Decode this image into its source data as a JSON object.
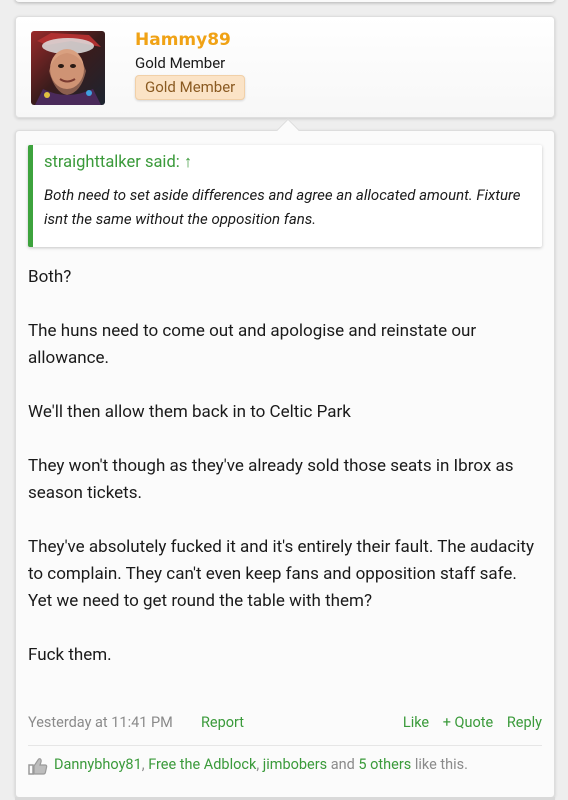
{
  "user": {
    "name": "Hammy89",
    "title": "Gold Member",
    "badge": "Gold Member"
  },
  "quote": {
    "author": "straighttalker said: ↑",
    "text": "Both need to set aside differences and agree an allocated amount. Fixture isnt the same without the opposition fans."
  },
  "post": {
    "paragraphs": [
      "Both?",
      "The huns need to come out and apologise and reinstate our allowance.",
      "We'll then allow them back in to Celtic Park",
      "They won't though as they've already sold those seats in Ibrox as season tickets.",
      "They've absolutely fucked it and it's entirely their fault. The audacity to complain. They can't even keep fans and opposition staff safe. Yet we need to get round the table with them?",
      "Fuck them."
    ],
    "timestamp": "Yesterday at 11:41 PM",
    "report": "Report",
    "like": "Like",
    "quote_action": "+ Quote",
    "reply": "Reply"
  },
  "likes": {
    "users": [
      "Dannybhoy81",
      "Free the Adblock",
      "jimbobers"
    ],
    "sep": ", ",
    "and": " and ",
    "others": "5 others",
    "suffix": " like this."
  },
  "colors": {
    "accent_green": "#3a9a3a",
    "username_orange": "#f0a215",
    "badge_bg": "#fbe3c6"
  },
  "icons": [
    "thumbs-up-icon"
  ]
}
